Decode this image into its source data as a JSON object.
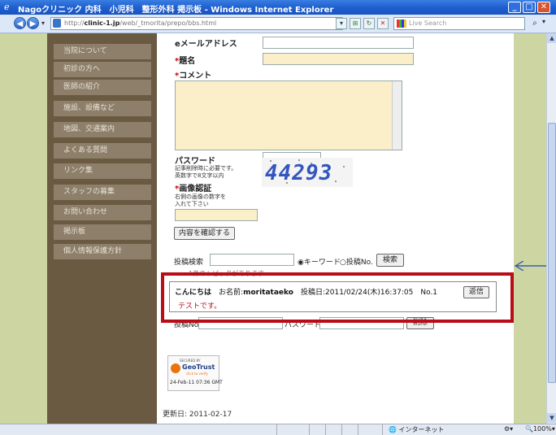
{
  "window": {
    "title": "Nagoクリニック 内科　小児科　整形外科 掲示板 - Windows Internet Explorer"
  },
  "address_bar": {
    "url_prefix": "http://",
    "url_host": "clinic-1.jp",
    "url_path": "/web/_tmorita/prepo/bbs.html",
    "search_placeholder": "Live Search"
  },
  "sidebar": {
    "items": [
      {
        "label": "当院について"
      },
      {
        "label": "初診の方へ"
      },
      {
        "label": "医師の紹介"
      },
      {
        "label": "施設、設備など"
      },
      {
        "label": "地図、交通案内"
      },
      {
        "label": "よくある質問"
      },
      {
        "label": "リンク集"
      },
      {
        "label": "スタッフの募集"
      },
      {
        "label": "お問い合わせ"
      },
      {
        "label": "掲示板"
      },
      {
        "label": "個人情報保護方針"
      }
    ]
  },
  "form": {
    "email_label": "eメールアドレス",
    "required_mark": "*",
    "title_label": "題名",
    "comment_label": "コメント",
    "password_label": "パスワード",
    "password_hint_1": "記事削除時に必要です。",
    "password_hint_2": "英数字で8文字以内",
    "captcha_label": "画像認証",
    "captcha_hint_1": "右側の画像の数字を",
    "captcha_hint_2": "入れて下さい",
    "captcha_value": "44293",
    "confirm_button": "内容を確認する"
  },
  "search": {
    "label": "投稿検索",
    "option_keyword": "キーワード",
    "option_number": "投稿No.",
    "button": "検索",
    "result_text": "1件のトピックがあります"
  },
  "post": {
    "heading": "こんにちは",
    "name_label": "お名前:",
    "name": "moritataeko",
    "date_label": "投稿日:",
    "date": "2011/02/24(木)16:37:05",
    "number": "No.1",
    "reply_button": "返信",
    "body": "テストです。"
  },
  "delete_row": {
    "number_label": "投稿No.",
    "password_label": "パスワード",
    "button": "削除"
  },
  "geotrust": {
    "secured_by": "SECURED BY",
    "brand": "GeoTrust",
    "verify": "click to verify",
    "date": "24-Feb-11 07:36 GMT"
  },
  "footer": {
    "updated": "更新日: 2011-02-17"
  },
  "status_bar": {
    "zone": "インターネット",
    "zoom": "100%"
  }
}
